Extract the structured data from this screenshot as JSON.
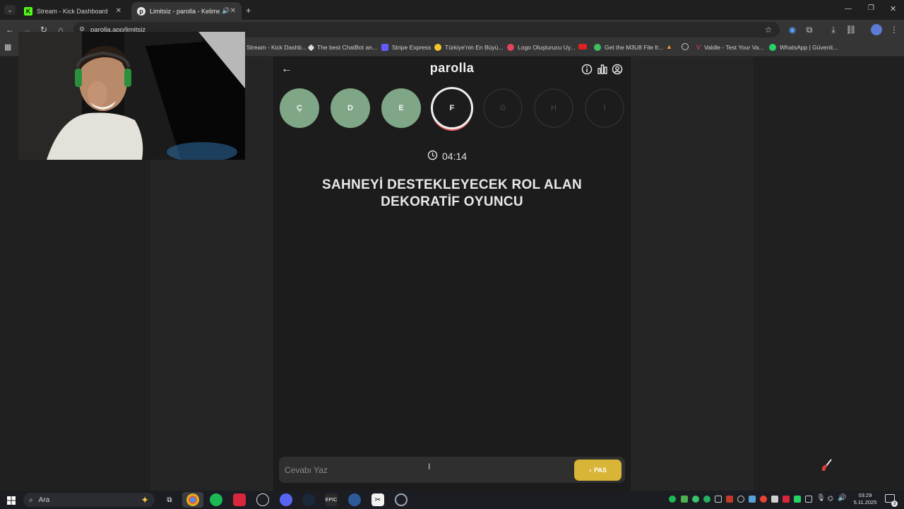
{
  "browser": {
    "tabs": [
      {
        "title": "Stream - Kick Dashboard",
        "active": false
      },
      {
        "title": "Limitsiz - parolla - Kelime o",
        "active": true
      }
    ],
    "url": "parolla.app/limitsiz",
    "bookmarks": [
      "Stream - Kick Dashb...",
      "The best ChatBot an...",
      "Stripe Express",
      "Türkiye'nin En Büyü...",
      "Logo Oluşturucu Uy...",
      "Get the M3U8 File fr...",
      "Valdle - Test Your Va...",
      "WhatsApp | Güvenli..."
    ]
  },
  "game": {
    "logo": "parolla",
    "letters": [
      {
        "char": "Ç",
        "state": "done"
      },
      {
        "char": "D",
        "state": "done"
      },
      {
        "char": "E",
        "state": "done"
      },
      {
        "char": "F",
        "state": "current"
      },
      {
        "char": "G",
        "state": "future"
      },
      {
        "char": "H",
        "state": "future"
      },
      {
        "char": "İ",
        "state": "future"
      }
    ],
    "timer": "04:14",
    "question_line1": "SAHNEYİ DESTEKLEYECEK ROL ALAN",
    "question_line2": "DEKORATİF OYUNCU",
    "answer_placeholder": "Cevabı Yaz",
    "pass_label": "PAS"
  },
  "colors": {
    "done": "#7fa686",
    "pass": "#d8b437",
    "current_ring_accent": "#e35a5a"
  },
  "taskbar": {
    "search_label": "Ara",
    "time": "03:29",
    "date": "5.11.2025",
    "notifications": "3"
  }
}
